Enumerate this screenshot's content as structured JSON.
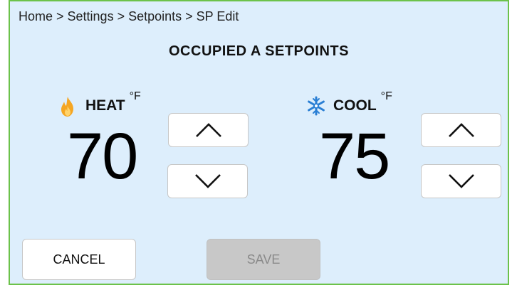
{
  "breadcrumb": "Home > Settings > Setpoints > SP Edit",
  "title": "OCCUPIED A SETPOINTS",
  "heat": {
    "icon": "flame-icon",
    "label": "HEAT",
    "unit": "°F",
    "value": "70"
  },
  "cool": {
    "icon": "snowflake-icon",
    "label": "COOL",
    "unit": "°F",
    "value": "75"
  },
  "buttons": {
    "cancel": "CANCEL",
    "save": "SAVE"
  },
  "colors": {
    "background": "#ddeefc",
    "border": "#6cc24a",
    "flame": "#f5a623",
    "snowflake": "#2a7fd4",
    "save_disabled": "#c8c8c8"
  }
}
